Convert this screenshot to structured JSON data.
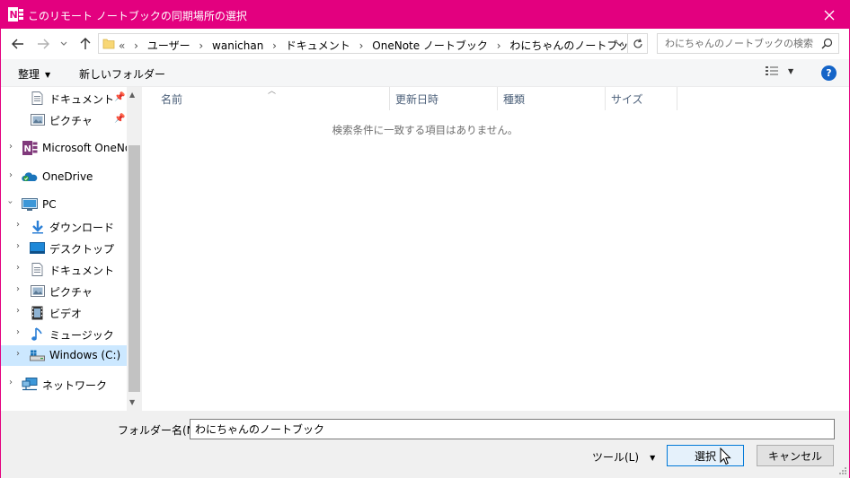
{
  "window": {
    "title": "このリモート ノートブックの同期場所の選択",
    "accent": "#e3007f"
  },
  "address": {
    "overflow": "«",
    "crumbs": [
      "ユーザー",
      "wanichan",
      "ドキュメント",
      "OneNote ノートブック",
      "わにちゃんのノートブック"
    ]
  },
  "search": {
    "placeholder": "わにちゃんのノートブックの検索"
  },
  "toolbar": {
    "organize": "整理",
    "new_folder": "新しいフォルダー"
  },
  "nav": {
    "quick_documents": "ドキュメント",
    "quick_pictures": "ピクチャ",
    "onenote": "Microsoft OneNote",
    "onedrive": "OneDrive",
    "pc": "PC",
    "downloads": "ダウンロード",
    "desktop": "デスクトップ",
    "documents": "ドキュメント",
    "pictures": "ピクチャ",
    "videos": "ビデオ",
    "music": "ミュージック",
    "windows_c": "Windows (C:)",
    "network": "ネットワーク"
  },
  "columns": {
    "name": "名前",
    "date": "更新日時",
    "type": "種類",
    "size": "サイズ"
  },
  "empty_message": "検索条件に一致する項目はありません。",
  "bottom": {
    "folder_name_label": "フォルダー名(N):",
    "folder_name_value": "わにちゃんのノートブック",
    "tools": "ツール(L)",
    "select": "選択",
    "cancel": "キャンセル"
  }
}
